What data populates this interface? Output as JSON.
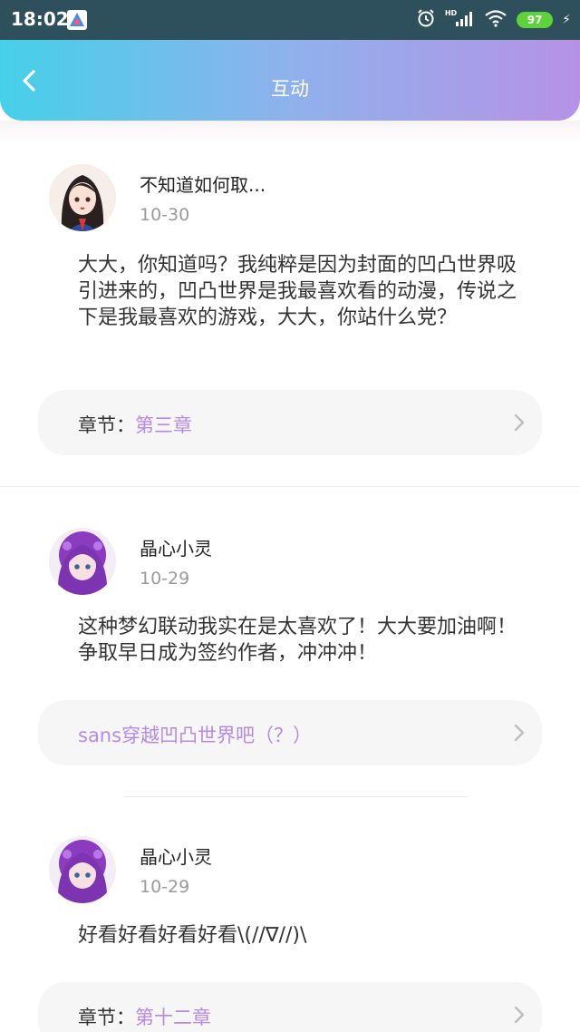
{
  "status_bar": {
    "time": "18:02",
    "network": "HD",
    "battery": "97",
    "colors": {
      "background": "#2e4f5c",
      "battery": "#5fd23a"
    }
  },
  "header": {
    "title": "互动",
    "colors": {
      "gradient_start": "#45d0ea",
      "gradient_end": "#b692e6"
    }
  },
  "accent_color": "#b58be2",
  "posts": [
    {
      "username": "不知道如何取...",
      "date": "10-30",
      "content": "大大，你知道吗？我纯粹是因为封面的凹凸世界吸引进来的，凹凸世界是我最喜欢看的动漫，传说之下是我最喜欢的游戏，大大，你站什么党？",
      "chapter_label": "章节：",
      "chapter_name": "第三章"
    },
    {
      "username": "晶心小灵",
      "date": "10-29",
      "content": "这种梦幻联动我实在是太喜欢了！大大要加油啊！争取早日成为签约作者，冲冲冲！",
      "chapter_text": "sans穿越凹凸世界吧（？）"
    },
    {
      "username": "晶心小灵",
      "date": "10-29",
      "content": "好看好看好看好看\\(//∇//)\\",
      "chapter_label": "章节：",
      "chapter_name": "第十二章"
    }
  ]
}
